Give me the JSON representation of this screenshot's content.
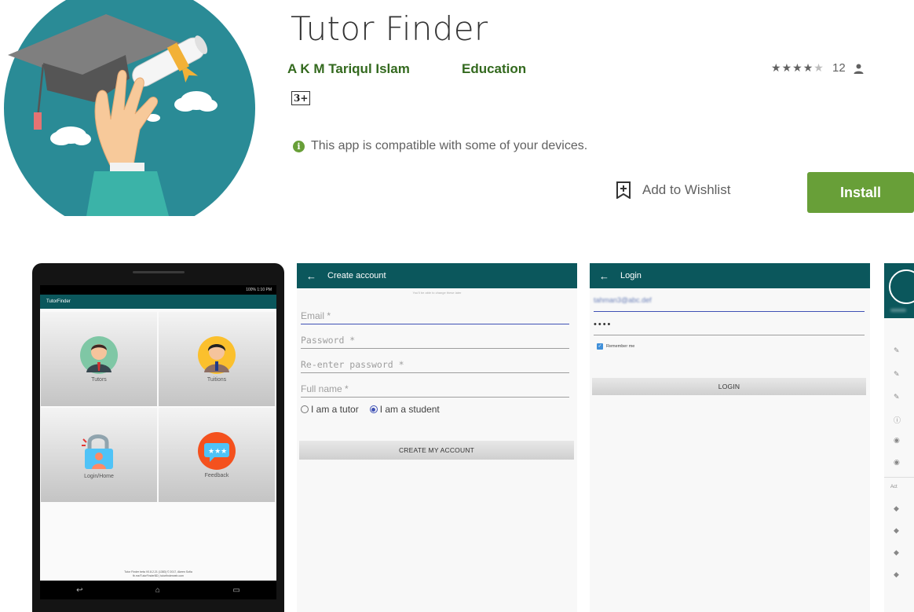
{
  "app": {
    "title": "Tutor Finder",
    "developer": "A K M Tariqul Islam",
    "category": "Education",
    "rating_stars": 4,
    "rating_count": "12",
    "content_rating": "3+",
    "compat_note": "This app is compatible with some of your devices.",
    "wishlist_label": "Add to Wishlist",
    "install_label": "Install",
    "icons": [
      "graduation-cap-icon",
      "diploma-icon",
      "hand-icon",
      "info-icon",
      "wishlist-icon",
      "person-icon"
    ]
  },
  "colors": {
    "accent_green": "#689f38",
    "dev_green": "#33691e",
    "app_teal": "#0b575c",
    "icon_teal": "#2a8b96"
  },
  "screenshots": {
    "home": {
      "status": "100%",
      "time": "1:10 PM",
      "app_name": "TutorFinder",
      "tiles": [
        {
          "label": "Tutors"
        },
        {
          "label": "Tuitions"
        },
        {
          "label": "Login/Home"
        },
        {
          "label": "Feedback"
        }
      ],
      "footer_line1": "Tutor Finder beta V0.8.2.21 (1383) © 2017, Akeen Sofia",
      "footer_line2": "fb.me/TutorFinderBD | tutorfinderweb.com"
    },
    "create_account": {
      "title": "Create account",
      "hint": "You'll be able to change these later",
      "email_placeholder": "Email *",
      "password_placeholder": "Password *",
      "reenter_placeholder": "Re-enter password *",
      "fullname_placeholder": "Full name *",
      "radio_tutor": "I am a tutor",
      "radio_student": "I am a student",
      "button": "CREATE MY ACCOUNT"
    },
    "login": {
      "title": "Login",
      "email_value": "tahman3@abc.def",
      "password_value": "••••",
      "remember": "Remember me",
      "button": "LOGIN"
    },
    "partial": {
      "section": "Act"
    }
  }
}
